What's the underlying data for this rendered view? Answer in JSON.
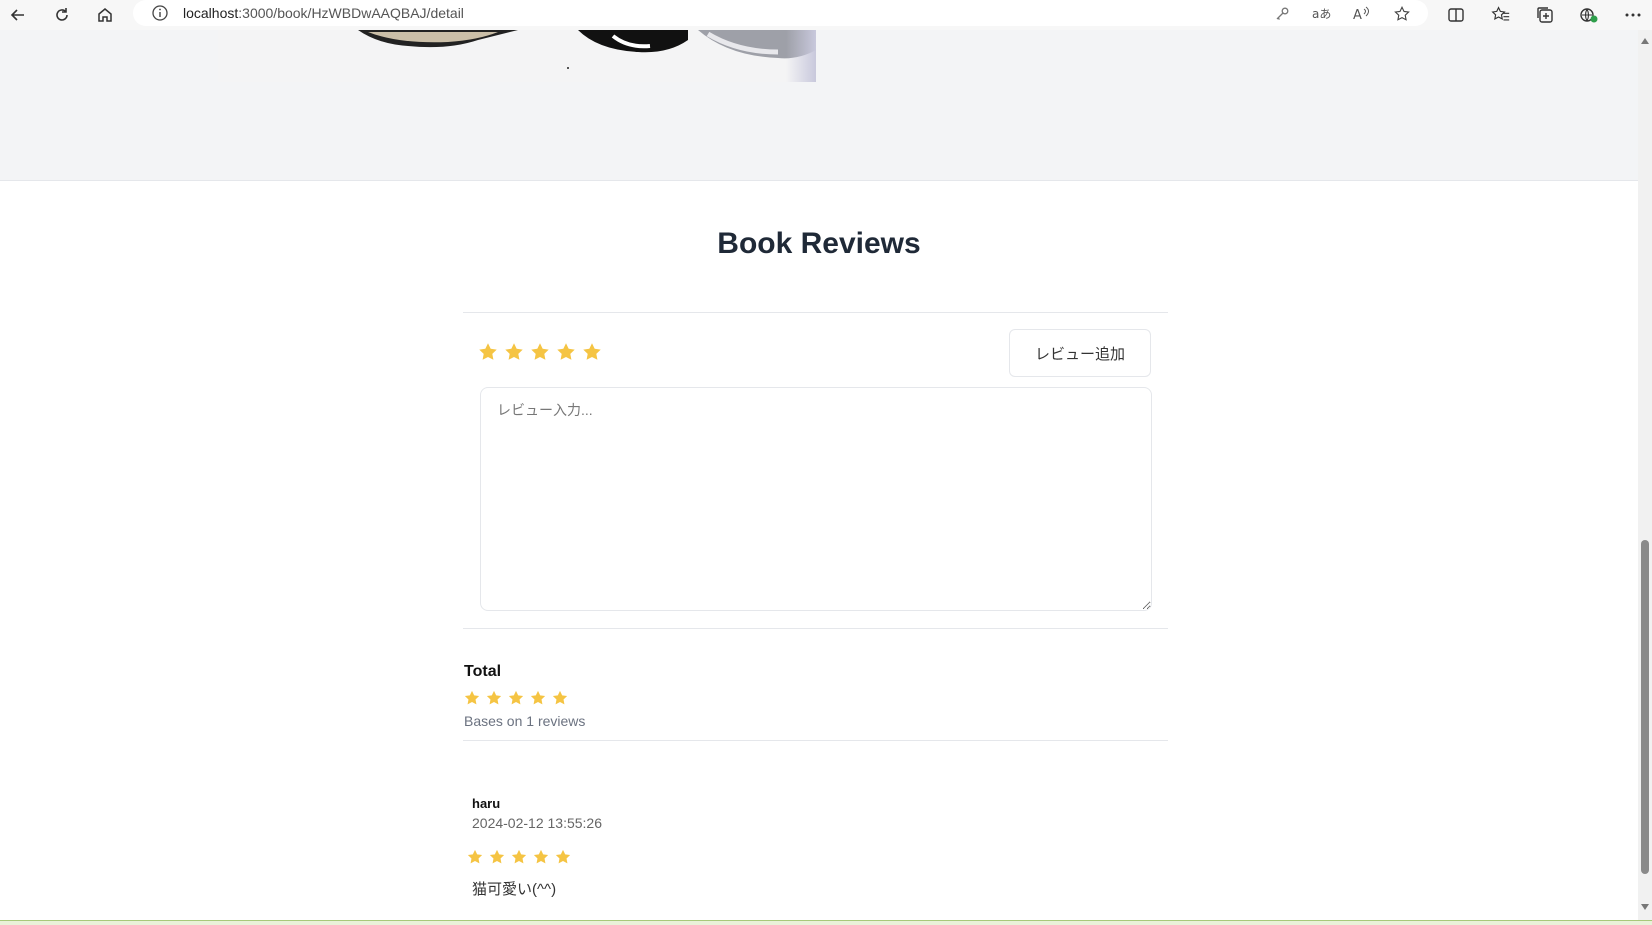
{
  "browser": {
    "url_host": "localhost",
    "url_path": ":3000/book/HzWBDwAAQBAJ/detail"
  },
  "page": {
    "title": "Book Reviews",
    "add_review_button": "レビュー追加",
    "review_placeholder": "レビュー入力...",
    "input_rating": 5,
    "total": {
      "label": "Total",
      "rating": 5,
      "bases_text": "Bases on 1 reviews"
    },
    "reviews": [
      {
        "user": "haru",
        "date": "2024-02-12 13:55:26",
        "rating": 5,
        "text": "猫可愛い(^^)"
      }
    ]
  },
  "colors": {
    "star": "#f5c443",
    "hero_bg": "#f3f4f6"
  }
}
